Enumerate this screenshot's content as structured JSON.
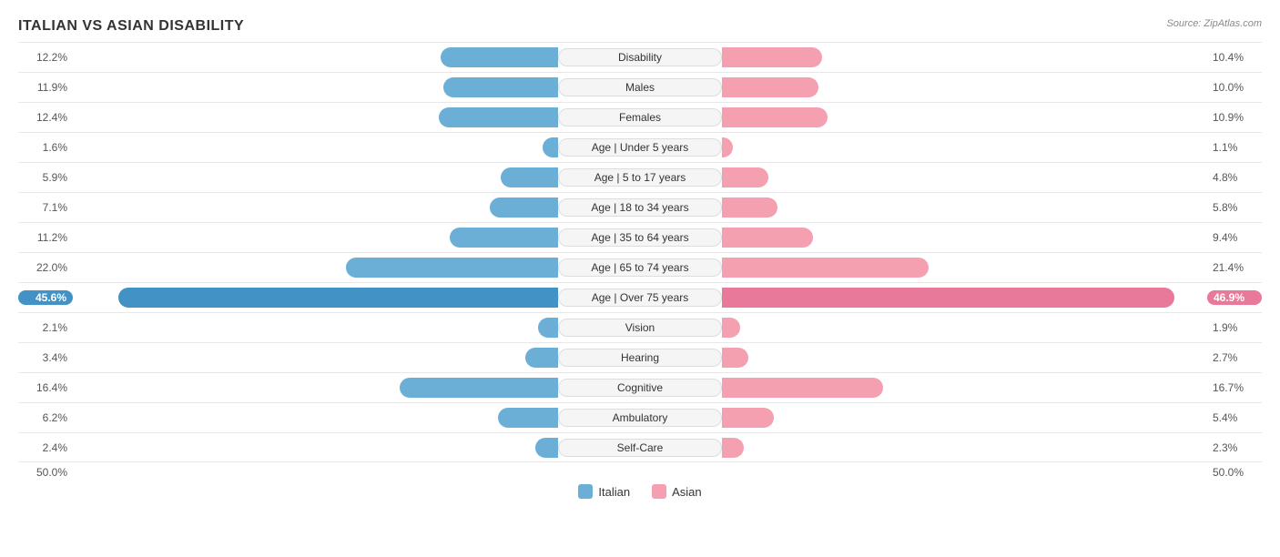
{
  "title": "ITALIAN VS ASIAN DISABILITY",
  "source": "Source: ZipAtlas.com",
  "max_bar_width": 560,
  "max_value": 50,
  "axis": {
    "left": "50.0%",
    "right": "50.0%"
  },
  "legend": {
    "italian_label": "Italian",
    "asian_label": "Asian"
  },
  "rows": [
    {
      "label": "Disability",
      "left_val": "12.2%",
      "left_pct": 12.2,
      "right_val": "10.4%",
      "right_pct": 10.4,
      "highlight": false
    },
    {
      "label": "Males",
      "left_val": "11.9%",
      "left_pct": 11.9,
      "right_val": "10.0%",
      "right_pct": 10.0,
      "highlight": false
    },
    {
      "label": "Females",
      "left_val": "12.4%",
      "left_pct": 12.4,
      "right_val": "10.9%",
      "right_pct": 10.9,
      "highlight": false
    },
    {
      "label": "Age | Under 5 years",
      "left_val": "1.6%",
      "left_pct": 1.6,
      "right_val": "1.1%",
      "right_pct": 1.1,
      "highlight": false
    },
    {
      "label": "Age | 5 to 17 years",
      "left_val": "5.9%",
      "left_pct": 5.9,
      "right_val": "4.8%",
      "right_pct": 4.8,
      "highlight": false
    },
    {
      "label": "Age | 18 to 34 years",
      "left_val": "7.1%",
      "left_pct": 7.1,
      "right_val": "5.8%",
      "right_pct": 5.8,
      "highlight": false
    },
    {
      "label": "Age | 35 to 64 years",
      "left_val": "11.2%",
      "left_pct": 11.2,
      "right_val": "9.4%",
      "right_pct": 9.4,
      "highlight": false
    },
    {
      "label": "Age | 65 to 74 years",
      "left_val": "22.0%",
      "left_pct": 22.0,
      "right_val": "21.4%",
      "right_pct": 21.4,
      "highlight": false
    },
    {
      "label": "Age | Over 75 years",
      "left_val": "45.6%",
      "left_pct": 45.6,
      "right_val": "46.9%",
      "right_pct": 46.9,
      "highlight": true
    },
    {
      "label": "Vision",
      "left_val": "2.1%",
      "left_pct": 2.1,
      "right_val": "1.9%",
      "right_pct": 1.9,
      "highlight": false
    },
    {
      "label": "Hearing",
      "left_val": "3.4%",
      "left_pct": 3.4,
      "right_val": "2.7%",
      "right_pct": 2.7,
      "highlight": false
    },
    {
      "label": "Cognitive",
      "left_val": "16.4%",
      "left_pct": 16.4,
      "right_val": "16.7%",
      "right_pct": 16.7,
      "highlight": false
    },
    {
      "label": "Ambulatory",
      "left_val": "6.2%",
      "left_pct": 6.2,
      "right_val": "5.4%",
      "right_pct": 5.4,
      "highlight": false
    },
    {
      "label": "Self-Care",
      "left_val": "2.4%",
      "left_pct": 2.4,
      "right_val": "2.3%",
      "right_pct": 2.3,
      "highlight": false
    }
  ]
}
